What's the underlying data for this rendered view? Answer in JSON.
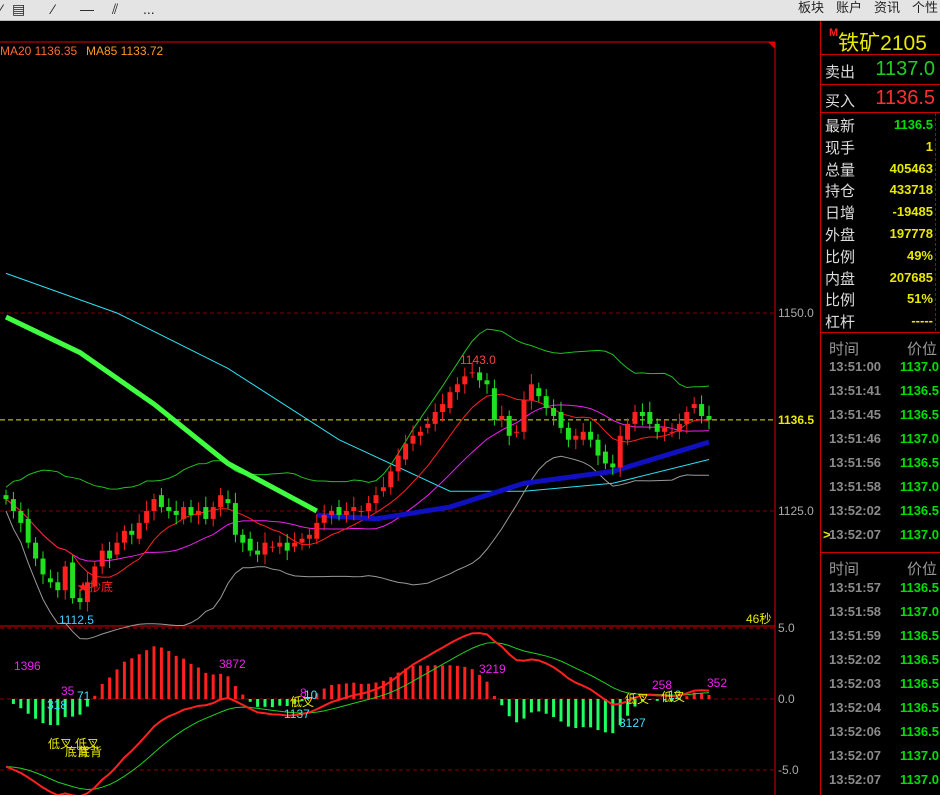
{
  "toolbar": {
    "icons": [
      "draw-line-icon",
      "layout-icon",
      "line-icon",
      "horizontal-line-icon",
      "parallel-line-icon",
      "more-icon"
    ],
    "more": "...",
    "menu": [
      "板块",
      "账户",
      "资讯",
      "个性"
    ]
  },
  "legend": {
    "ma20": "MA20 1136.35",
    "ma85": "MA85 1133.72"
  },
  "axis": {
    "main": [
      "1150.0",
      "1136.5",
      "1125.0"
    ],
    "macd": [
      "5.0",
      "0.0",
      "-5.0"
    ]
  },
  "annotations": {
    "high": "1143.0",
    "low": "1112.5",
    "buy_bottom": "抄底",
    "countdown": "46秒"
  },
  "macd_labels": {
    "magenta": [
      "1396",
      "3872",
      "35",
      "3219",
      "258",
      "352",
      "8"
    ],
    "cyan": [
      "318",
      "71",
      "1137",
      "10",
      "3127",
      "12"
    ],
    "yellow": [
      "低叉",
      "低叉",
      "底背",
      "底背",
      "低叉",
      "低叉",
      "低叉",
      "低叉"
    ]
  },
  "quote": {
    "flag": "M",
    "name": "铁矿2105",
    "sell_label": "卖出",
    "sell": "1137.0",
    "buy_label": "买入",
    "buy": "1136.5",
    "stats": [
      {
        "k": "最新",
        "v": "1136.5",
        "c": "#00e000"
      },
      {
        "k": "现手",
        "v": "1"
      },
      {
        "k": "总量",
        "v": "405463"
      },
      {
        "k": "持仓",
        "v": "433718"
      },
      {
        "k": "日增",
        "v": "-19485"
      },
      {
        "k": "外盘",
        "v": "197778"
      },
      {
        "k": "比例",
        "v": "49%"
      },
      {
        "k": "内盘",
        "v": "207685"
      },
      {
        "k": "比例",
        "v": "51%"
      },
      {
        "k": "杠杆",
        "v": "-----"
      }
    ]
  },
  "ticks1": {
    "h1": "时间",
    "h2": "价位",
    "rows": [
      [
        "13:51:00",
        "1137.0"
      ],
      [
        "13:51:41",
        "1136.5"
      ],
      [
        "13:51:45",
        "1136.5"
      ],
      [
        "13:51:46",
        "1137.0"
      ],
      [
        "13:51:56",
        "1136.5"
      ],
      [
        "13:51:58",
        "1137.0"
      ],
      [
        "13:52:02",
        "1136.5"
      ],
      [
        "13:52:07",
        "1137.0"
      ]
    ],
    "marker": ">"
  },
  "ticks2": {
    "h1": "时间",
    "h2": "价位",
    "rows": [
      [
        "13:51:57",
        "1136.5"
      ],
      [
        "13:51:58",
        "1137.0"
      ],
      [
        "13:51:59",
        "1136.5"
      ],
      [
        "13:52:02",
        "1136.5"
      ],
      [
        "13:52:03",
        "1136.5"
      ],
      [
        "13:52:04",
        "1136.5"
      ],
      [
        "13:52:06",
        "1136.5"
      ],
      [
        "13:52:07",
        "1137.0"
      ],
      [
        "13:52:07",
        "1137.0"
      ]
    ]
  },
  "colors": {
    "up": "#ff2020",
    "down": "#20e020",
    "yellow": "#e8e800",
    "grid": "#a00000"
  },
  "chart_data": {
    "type": "candlestick",
    "ylim": [
      1108.5,
      1155
    ],
    "last": 1136.5,
    "closes": [
      1126.5,
      1125,
      1123.5,
      1121,
      1119,
      1117,
      1116,
      1115,
      1118,
      1114,
      1113.5,
      1116,
      1118,
      1120,
      1119,
      1121,
      1122.5,
      1122,
      1123.5,
      1125,
      1126.5,
      1125.5,
      1125,
      1124.5,
      1125.5,
      1124.5,
      1125,
      1124,
      1125.5,
      1127,
      1126,
      1122,
      1121,
      1120,
      1119.5,
      1121,
      1120.5,
      1121,
      1120,
      1121,
      1121.5,
      1122,
      1123.5,
      1124.5,
      1125,
      1124.5,
      1125,
      1125.5,
      1125,
      1126,
      1127,
      1128,
      1130,
      1132,
      1133.5,
      1134.5,
      1135,
      1136,
      1137.5,
      1138.5,
      1140,
      1141,
      1142,
      1142.5,
      1141.5,
      1141,
      1136.5,
      1137,
      1134.5,
      1135,
      1139,
      1141,
      1139.5,
      1138,
      1137,
      1135.5,
      1134,
      1134.5,
      1135,
      1134,
      1132,
      1131,
      1130.5,
      1134.5,
      1136,
      1137.5,
      1137,
      1136,
      1135,
      1135.5,
      1135,
      1136,
      1137.5,
      1138.5,
      1137,
      1136.5
    ],
    "ma_long": [
      [
        0,
        1149.5
      ],
      [
        10,
        1145
      ],
      [
        20,
        1138.5
      ],
      [
        30,
        1131
      ],
      [
        40,
        1126
      ],
      [
        42,
        1125
      ]
    ],
    "ma85": [
      [
        42,
        1124.5
      ],
      [
        50,
        1124
      ],
      [
        60,
        1125.5
      ],
      [
        70,
        1128.5
      ],
      [
        82,
        1130
      ],
      [
        95,
        1133.7
      ]
    ],
    "ma_cyan": [
      [
        0,
        1155
      ],
      [
        15,
        1150
      ],
      [
        30,
        1143
      ],
      [
        45,
        1134
      ],
      [
        60,
        1127.5
      ],
      [
        70,
        1127.5
      ],
      [
        82,
        1128.5
      ],
      [
        95,
        1131.5
      ]
    ]
  }
}
